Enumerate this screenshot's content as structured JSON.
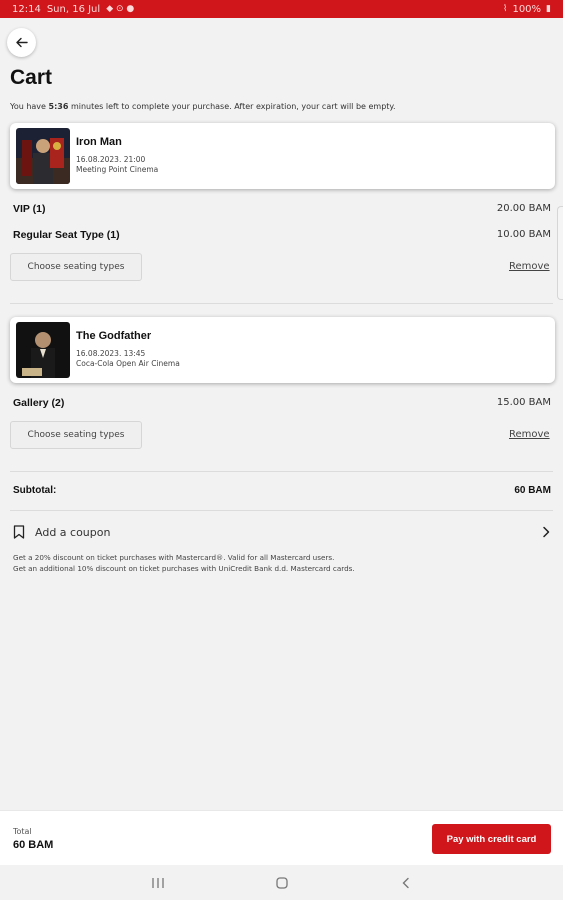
{
  "status_bar": {
    "time": "12:14",
    "date": "Sun, 16 Jul",
    "battery": "100%"
  },
  "header": {
    "title": "Cart",
    "timer_prefix": "You have ",
    "timer_value": "5:36",
    "timer_suffix": " minutes left to complete your purchase. After expiration, your cart will be empty."
  },
  "cart": {
    "items": [
      {
        "title": "Iron Man",
        "datetime": "16.08.2023. 21:00",
        "venue": "Meeting Point Cinema",
        "seats": [
          {
            "name": "VIP (1)",
            "price": "20.00 BAM"
          },
          {
            "name": "Regular Seat Type (1)",
            "price": "10.00 BAM"
          }
        ],
        "choose_label": "Choose seating types",
        "remove_label": "Remove"
      },
      {
        "title": "The Godfather",
        "datetime": "16.08.2023. 13:45",
        "venue": "Coca-Cola Open Air Cinema",
        "seats": [
          {
            "name": "Gallery (2)",
            "price": "15.00 BAM"
          }
        ],
        "choose_label": "Choose seating types",
        "remove_label": "Remove"
      }
    ]
  },
  "summary": {
    "subtotal_label": "Subtotal:",
    "subtotal_value": "60 BAM"
  },
  "coupon": {
    "label": "Add a coupon",
    "promo_lines": [
      "Get a 20% discount on ticket purchases with Mastercard®. Valid for all Mastercard users.",
      "Get an additional 10% discount on ticket purchases with UniCredit Bank d.d. Mastercard cards."
    ]
  },
  "footer": {
    "total_label": "Total",
    "total_value": "60 BAM",
    "pay_label": "Pay with credit card"
  },
  "colors": {
    "accent": "#d0161b",
    "background": "#f2f2f2"
  },
  "icons": {
    "back": "arrow-left-icon",
    "coupon": "bookmark-icon",
    "chevron": "chevron-right-icon",
    "nav_recents": "recents-icon",
    "nav_home": "home-icon",
    "nav_back": "nav-back-icon"
  }
}
